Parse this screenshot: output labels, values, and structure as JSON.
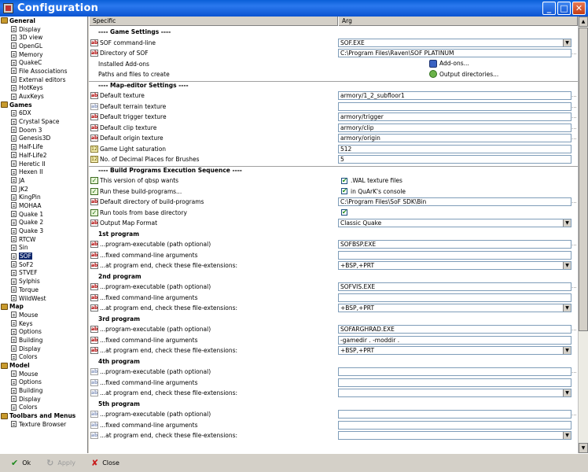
{
  "window": {
    "title": "Configuration",
    "controls": {
      "minimize": "_",
      "maximize": "□",
      "close": "✕"
    }
  },
  "tree": [
    {
      "label": "General",
      "group": true
    },
    {
      "label": "Display"
    },
    {
      "label": "3D view"
    },
    {
      "label": "OpenGL"
    },
    {
      "label": "Memory"
    },
    {
      "label": "QuakeC"
    },
    {
      "label": "File Associations"
    },
    {
      "label": "External editors"
    },
    {
      "label": "HotKeys"
    },
    {
      "label": "AuxKeys"
    },
    {
      "label": "Games",
      "group": true
    },
    {
      "label": "6DX"
    },
    {
      "label": "Crystal Space"
    },
    {
      "label": "Doom 3"
    },
    {
      "label": "Genesis3D"
    },
    {
      "label": "Half-Life"
    },
    {
      "label": "Half-Life2"
    },
    {
      "label": "Heretic II"
    },
    {
      "label": "Hexen II"
    },
    {
      "label": "JA"
    },
    {
      "label": "JK2"
    },
    {
      "label": "KingPin"
    },
    {
      "label": "MOHAA"
    },
    {
      "label": "Quake 1"
    },
    {
      "label": "Quake 2"
    },
    {
      "label": "Quake 3"
    },
    {
      "label": "RTCW"
    },
    {
      "label": "Sin"
    },
    {
      "label": "SOF",
      "selected": true
    },
    {
      "label": "SoF2"
    },
    {
      "label": "STVEF"
    },
    {
      "label": "Sylphis"
    },
    {
      "label": "Torque"
    },
    {
      "label": "WildWest"
    },
    {
      "label": "Map",
      "group": true
    },
    {
      "label": "Mouse"
    },
    {
      "label": "Keys"
    },
    {
      "label": "Options"
    },
    {
      "label": "Building"
    },
    {
      "label": "Display"
    },
    {
      "label": "Colors"
    },
    {
      "label": "Model",
      "group": true
    },
    {
      "label": "Mouse"
    },
    {
      "label": "Options"
    },
    {
      "label": "Building"
    },
    {
      "label": "Display"
    },
    {
      "label": "Colors"
    },
    {
      "label": "Toolbars and Menus",
      "group": true
    },
    {
      "label": "Texture Browser"
    }
  ],
  "columns": {
    "specific": "Specific",
    "arg": "Arg"
  },
  "rows": [
    {
      "kind": "section",
      "label": "---- Game Settings ----"
    },
    {
      "kind": "field",
      "icon": "ab",
      "label": "SOF command-line",
      "value": "SOF.EXE",
      "combo": true
    },
    {
      "kind": "field",
      "icon": "ab",
      "label": "Directory of SOF",
      "value": "C:\\Program Files\\Raven\\SOF PLATINUM",
      "dots": "..."
    },
    {
      "kind": "button",
      "icon": "",
      "label": "Installed Add-ons",
      "btnlabel": "Add-ons...",
      "btnicon": "addons"
    },
    {
      "kind": "button",
      "icon": "",
      "label": "Paths and files to create",
      "btnlabel": "Output directories...",
      "btnicon": "output"
    },
    {
      "kind": "section",
      "label": "---- Map-editor Settings ----",
      "sep": true
    },
    {
      "kind": "field",
      "icon": "ab",
      "label": "Default texture",
      "value": "armory/1_2_subfloor1",
      "dots": "..."
    },
    {
      "kind": "field",
      "icon": "ab-dim",
      "label": "Default terrain texture",
      "value": "",
      "dots": "..."
    },
    {
      "kind": "field",
      "icon": "ab",
      "label": "Default trigger texture",
      "value": "armory/trigger",
      "dots": "..."
    },
    {
      "kind": "field",
      "icon": "ab",
      "label": "Default clip texture",
      "value": "armory/clip",
      "dots": "..."
    },
    {
      "kind": "field",
      "icon": "ab",
      "label": "Default origin texture",
      "value": "armory/origin",
      "dots": "..."
    },
    {
      "kind": "field",
      "icon": "spin",
      "label": "Game Light saturation",
      "value": "512"
    },
    {
      "kind": "field",
      "icon": "spin",
      "label": "No. of Decimal Places for Brushes",
      "value": "5"
    },
    {
      "kind": "section",
      "label": "---- Build Programs Execution Sequence ----",
      "sep": true
    },
    {
      "kind": "check",
      "icon": "chk",
      "label": "This version of qbsp wants",
      "cblabel": ".WAL texture files"
    },
    {
      "kind": "check",
      "icon": "chk",
      "label": "Run these build-programs...",
      "cblabel": "in QuArK's console"
    },
    {
      "kind": "field",
      "icon": "ab",
      "label": "Default directory of build-programs",
      "value": "C:\\Program Files\\SoF SDK\\Bin",
      "dots": "..."
    },
    {
      "kind": "check",
      "icon": "chk",
      "label": "Run tools from base directory",
      "cblabel": ""
    },
    {
      "kind": "field",
      "icon": "ab",
      "label": "Output Map Format",
      "value": "Classic Quake",
      "combo": true
    },
    {
      "kind": "sub",
      "label": "1st program"
    },
    {
      "kind": "field",
      "icon": "ab",
      "label": "...program-executable (path optional)",
      "value": "SOFBSP.EXE",
      "dots": "..."
    },
    {
      "kind": "field",
      "icon": "ab",
      "label": "...fixed command-line arguments",
      "value": ""
    },
    {
      "kind": "field",
      "icon": "ab",
      "label": "...at program end, check these file-extensions:",
      "value": "+BSP,+PRT",
      "combo": true
    },
    {
      "kind": "sub",
      "label": "2nd program"
    },
    {
      "kind": "field",
      "icon": "ab",
      "label": "...program-executable (path optional)",
      "value": "SOFVIS.EXE",
      "dots": "..."
    },
    {
      "kind": "field",
      "icon": "ab",
      "label": "...fixed command-line arguments",
      "value": ""
    },
    {
      "kind": "field",
      "icon": "ab",
      "label": "...at program end, check these file-extensions:",
      "value": "+BSP,+PRT",
      "combo": true
    },
    {
      "kind": "sub",
      "label": "3rd program"
    },
    {
      "kind": "field",
      "icon": "ab",
      "label": "...program-executable (path optional)",
      "value": "SOFARGHRAD.EXE",
      "dots": "..."
    },
    {
      "kind": "field",
      "icon": "ab",
      "label": "...fixed command-line arguments",
      "value": "-gamedir . -moddir ."
    },
    {
      "kind": "field",
      "icon": "ab",
      "label": "...at program end, check these file-extensions:",
      "value": "+BSP,+PRT",
      "combo": true
    },
    {
      "kind": "sub",
      "label": "4th program"
    },
    {
      "kind": "field",
      "icon": "ab-dim",
      "label": "...program-executable (path optional)",
      "value": "",
      "dots": "..."
    },
    {
      "kind": "field",
      "icon": "ab-dim",
      "label": "...fixed command-line arguments",
      "value": ""
    },
    {
      "kind": "field",
      "icon": "ab-dim",
      "label": "...at program end, check these file-extensions:",
      "value": "",
      "combo": true
    },
    {
      "kind": "sub",
      "label": "5th program"
    },
    {
      "kind": "field",
      "icon": "ab-dim",
      "label": "...program-executable (path optional)",
      "value": "",
      "dots": "..."
    },
    {
      "kind": "field",
      "icon": "ab-dim",
      "label": "...fixed command-line arguments",
      "value": ""
    },
    {
      "kind": "field",
      "icon": "ab-dim",
      "label": "...at program end, check these file-extensions:",
      "value": "",
      "combo": true
    }
  ],
  "footer": {
    "ok": "Ok",
    "apply": "Apply",
    "close": "Close"
  },
  "colors": {
    "titlebar": "#0b53d0",
    "selection": "#0a246a",
    "face": "#d4d0c8"
  }
}
